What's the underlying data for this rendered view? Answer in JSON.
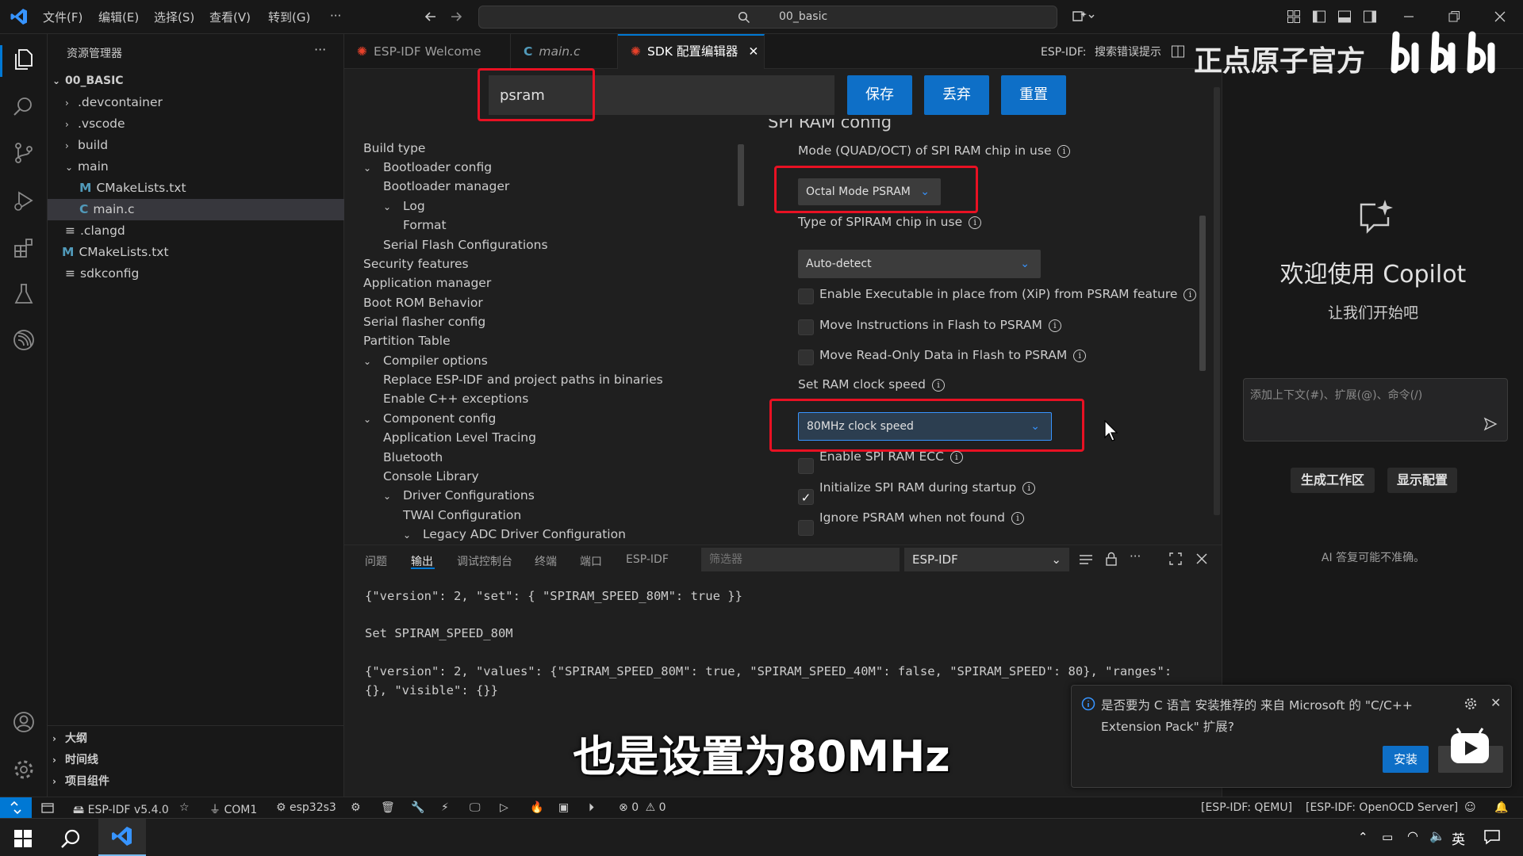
{
  "titlebar": {
    "menu": [
      "文件(F)",
      "编辑(E)",
      "选择(S)",
      "查看(V)",
      "转到(G)",
      "···"
    ],
    "search": "00_basic"
  },
  "sidebar": {
    "title": "资源管理器",
    "more": "···",
    "root": "00_BASIC",
    "tree": [
      {
        "label": ".devcontainer",
        "chev": "›",
        "kind": "folder"
      },
      {
        "label": ".vscode",
        "chev": "›",
        "kind": "folder"
      },
      {
        "label": "build",
        "chev": "›",
        "kind": "folder"
      },
      {
        "label": "main",
        "chev": "⌄",
        "kind": "folder"
      },
      {
        "label": "CMakeLists.txt",
        "glyph": "M",
        "kind": "cmake"
      },
      {
        "label": "main.c",
        "glyph": "C",
        "kind": "c"
      },
      {
        "label": ".clangd",
        "glyph": "≡",
        "kind": "file"
      },
      {
        "label": "CMakeLists.txt",
        "glyph": "M",
        "kind": "cmake"
      },
      {
        "label": "sdkconfig",
        "glyph": "≡",
        "kind": "file"
      }
    ],
    "sections": [
      "大纲",
      "时间线",
      "项目组件"
    ]
  },
  "tabs": [
    {
      "label": "ESP-IDF Welcome"
    },
    {
      "label": "main.c"
    },
    {
      "label": "SDK 配置编辑器",
      "close": "✕"
    }
  ],
  "tab_actions": {
    "esp_label": "ESP-IDF:",
    "hint": "搜索错误提示"
  },
  "sdk": {
    "filter_value": "psram",
    "buttons": {
      "save": "保存",
      "discard": "丢弃",
      "reset": "重置"
    },
    "nav": [
      {
        "label": "Build type",
        "chev": ""
      },
      {
        "label": "Bootloader config",
        "chev": "⌄"
      },
      {
        "label": "Bootloader manager",
        "chev": ""
      },
      {
        "label": "Log",
        "chev": "⌄"
      },
      {
        "label": "Format",
        "chev": ""
      },
      {
        "label": "Serial Flash Configurations",
        "chev": ""
      },
      {
        "label": "Security features",
        "chev": ""
      },
      {
        "label": "Application manager",
        "chev": ""
      },
      {
        "label": "Boot ROM Behavior",
        "chev": ""
      },
      {
        "label": "Serial flasher config",
        "chev": ""
      },
      {
        "label": "Partition Table",
        "chev": ""
      },
      {
        "label": "Compiler options",
        "chev": "⌄"
      },
      {
        "label": "Replace ESP-IDF and project paths in binaries",
        "chev": ""
      },
      {
        "label": "Enable C++ exceptions",
        "chev": ""
      },
      {
        "label": "Component config",
        "chev": "⌄"
      },
      {
        "label": "Application Level Tracing",
        "chev": ""
      },
      {
        "label": "Bluetooth",
        "chev": ""
      },
      {
        "label": "Console Library",
        "chev": ""
      },
      {
        "label": "Driver Configurations",
        "chev": "⌄"
      },
      {
        "label": "TWAI Configuration",
        "chev": ""
      },
      {
        "label": "Legacy ADC Driver Configuration",
        "chev": "⌄"
      }
    ],
    "section_title": "SPI RAM config",
    "mode_label": "Mode (QUAD/OCT) of SPI RAM chip in use",
    "mode_value": "Octal Mode PSRAM",
    "type_label": "Type of SPIRAM chip in use",
    "type_value": "Auto-detect",
    "checks": [
      {
        "label": "Enable Executable in place from (XiP) from PSRAM feature",
        "checked": false
      },
      {
        "label": "Move Instructions in Flash to PSRAM",
        "checked": false
      },
      {
        "label": "Move Read-Only Data in Flash to PSRAM",
        "checked": false
      }
    ],
    "clock_label": "Set RAM clock speed",
    "clock_value": "80MHz clock speed",
    "checks2": [
      {
        "label": "Enable SPI RAM ECC",
        "checked": false
      },
      {
        "label": "Initialize SPI RAM during startup",
        "checked": true,
        "mark": "✓"
      },
      {
        "label": "Ignore PSRAM when not found",
        "checked": false
      }
    ],
    "info_glyph": "i"
  },
  "panel": {
    "tabs": [
      "问题",
      "输出",
      "调试控制台",
      "终端",
      "端口",
      "ESP-IDF"
    ],
    "filter_placeholder": "筛选器",
    "channel": "ESP-IDF",
    "output": [
      "{\"version\": 2, \"set\": { \"SPIRAM_SPEED_80M\": true }}",
      "Set SPIRAM_SPEED_80M",
      "{\"version\": 2, \"values\": {\"SPIRAM_SPEED_80M\": true, \"SPIRAM_SPEED_40M\": false, \"SPIRAM_SPEED\": 80}, \"ranges\":",
      "{}, \"visible\": {}}"
    ],
    "more": "···"
  },
  "copilot": {
    "welcome": "欢迎使用 Copilot",
    "subtitle": "让我们开始吧",
    "input_placeholder": "添加上下文(#)、扩展(@)、命令(/)",
    "btn_workspace": "生成工作区",
    "btn_config": "显示配置",
    "disclaimer": "AI 答复可能不准确。"
  },
  "notification": {
    "text": "是否要为 C 语言 安装推荐的 来自 Microsoft 的 \"C/C++ Extension Pack\" 扩展?",
    "install": "安装",
    "close": "✕"
  },
  "statusbar": {
    "idf": "ESP-IDF v5.4.0",
    "port": "COM1",
    "chip": "esp32s3",
    "errors": "0",
    "warnings": "0",
    "qemu": "[ESP-IDF: QEMU]",
    "openocd": "[ESP-IDF: OpenOCD Server]"
  },
  "taskbar": {
    "ime": "英"
  },
  "overlay": {
    "subtitle": "也是设置为80MHz",
    "watermark": "正点原子官方"
  },
  "colors": {
    "accent": "#0078d4",
    "button": "#0e6fc7",
    "highlight": "#e81123"
  }
}
